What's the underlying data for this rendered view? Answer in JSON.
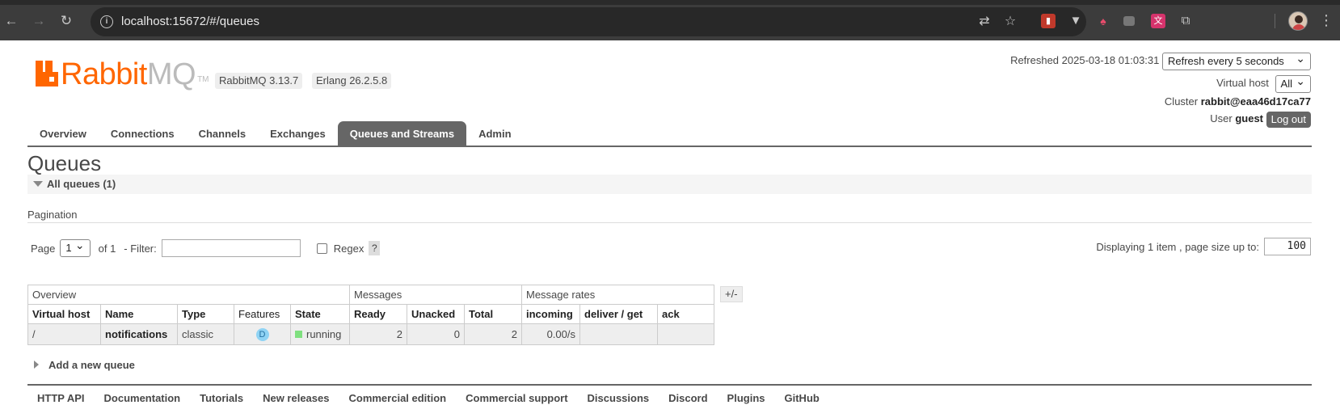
{
  "browser": {
    "url": "localhost:15672/#/queues"
  },
  "app": {
    "logo_rabbit": "Rabbit",
    "logo_mq": "MQ",
    "logo_tm": "TM",
    "version": "RabbitMQ 3.13.7",
    "erlang": "Erlang 26.2.5.8",
    "refreshed_label": "Refreshed 2025-03-18 01:03:31",
    "refresh_select": "Refresh every 5 seconds",
    "vhost_label": "Virtual host",
    "vhost_select": "All",
    "cluster_label": "Cluster",
    "cluster_value": "rabbit@eaa46d17ca77",
    "user_label": "User",
    "user_value": "guest",
    "logout": "Log out"
  },
  "tabs": [
    {
      "label": "Overview"
    },
    {
      "label": "Connections"
    },
    {
      "label": "Channels"
    },
    {
      "label": "Exchanges"
    },
    {
      "label": "Queues and Streams",
      "active": true
    },
    {
      "label": "Admin"
    }
  ],
  "page": {
    "title": "Queues",
    "section": "All queues (1)",
    "pagination_title": "Pagination",
    "page_label": "Page",
    "page_value": "1",
    "of_label": "of 1",
    "filter_label": "- Filter:",
    "filter_value": "",
    "regex_label": "Regex",
    "help": "?",
    "displaying": "Displaying 1 item , page size up to:",
    "page_size": "100",
    "plus_minus": "+/-",
    "add_queue": "Add a new queue"
  },
  "table": {
    "groups": [
      "Overview",
      "Messages",
      "Message rates"
    ],
    "columns": [
      "Virtual host",
      "Name",
      "Type",
      "Features",
      "State",
      "Ready",
      "Unacked",
      "Total",
      "incoming",
      "deliver / get",
      "ack"
    ],
    "rows": [
      {
        "vhost": "/",
        "name": "notifications",
        "type": "classic",
        "features": "D",
        "state": "running",
        "ready": "2",
        "unacked": "0",
        "total": "2",
        "incoming": "0.00/s",
        "deliver": "",
        "ack": ""
      }
    ]
  },
  "footer": [
    "HTTP API",
    "Documentation",
    "Tutorials",
    "New releases",
    "Commercial edition",
    "Commercial support",
    "Discussions",
    "Discord",
    "Plugins",
    "GitHub"
  ],
  "colors": {
    "brand_orange": "#ff6600",
    "tab_active": "#666666",
    "state_running": "#7fe07f"
  }
}
